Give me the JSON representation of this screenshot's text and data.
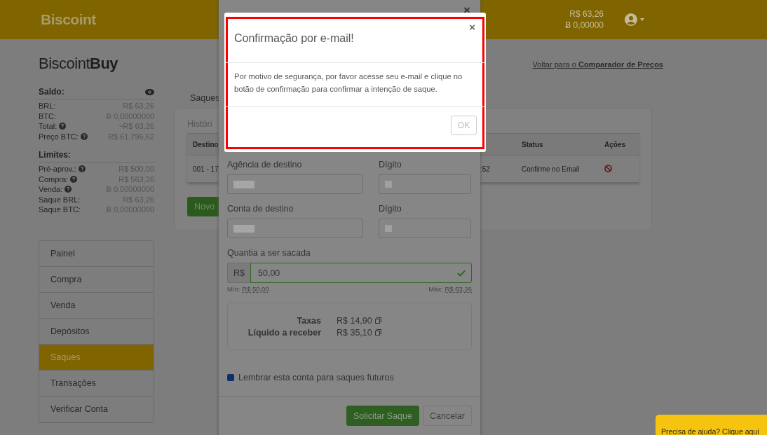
{
  "header": {
    "logo": "Biscoint",
    "balance_brl": "R$ 63,26",
    "balance_btc": "Ƀ 0,00000"
  },
  "sidebar": {
    "brand": "Biscoint**Buy**",
    "sections": [
      {
        "title": "Saldo:",
        "eye": true,
        "rows": [
          {
            "label": "BRL:",
            "help": false,
            "value": "R$ 63,26"
          },
          {
            "label": "BTC:",
            "help": false,
            "value": "Ƀ 0,00000000"
          },
          {
            "label": "Total:",
            "help": true,
            "value": "~R$ 63,26"
          },
          {
            "label": "Preço BTC:",
            "help": true,
            "value": "R$ 61.796,62"
          }
        ]
      },
      {
        "title": "Limites:",
        "eye": false,
        "rows": [
          {
            "label": "Pré-aprov.:",
            "help": true,
            "value": "R$ 500,00"
          },
          {
            "label": "Compra:",
            "help": true,
            "value": "R$ 563,26"
          },
          {
            "label": "Venda:",
            "help": true,
            "value": "Ƀ 0,00000000"
          },
          {
            "label": "Saque BRL:",
            "help": false,
            "value": "R$ 63,26"
          },
          {
            "label": "Saque BTC:",
            "help": false,
            "value": "Ƀ 0,00000000"
          }
        ]
      }
    ],
    "nav": [
      {
        "label": "Painel",
        "selected": false
      },
      {
        "label": "Compra",
        "selected": false
      },
      {
        "label": "Venda",
        "selected": false
      },
      {
        "label": "Depósitos",
        "selected": false
      },
      {
        "label": "Saques",
        "selected": true
      },
      {
        "label": "Transações",
        "selected": false
      },
      {
        "label": "Verificar Conta",
        "selected": false
      }
    ]
  },
  "back_link": "Voltar para o **Comparador de Preços**",
  "content": {
    "tab": "Saques",
    "panel_title": "Históri",
    "table": {
      "columns": [
        {
          "label": "Destino"
        },
        {
          "label": "Status"
        },
        {
          "label": "Ações"
        }
      ],
      "rows": [
        {
          "destino": "001 - 17",
          "column_2": ":52",
          "status": "Confirme no Email"
        }
      ]
    },
    "new_button": "Novo"
  },
  "withdraw_form": {
    "field_rows": [
      [
        {
          "label": "Agência de destino"
        },
        {
          "label": "Dígito"
        }
      ],
      [
        {
          "label": "Conta de destino"
        },
        {
          "label": "Dígito"
        }
      ]
    ],
    "amount": {
      "label": "Quantia a ser sacada",
      "prefix": "R$",
      "value": "50,00",
      "valid": true,
      "min_label": "Mín:",
      "min": "R$ 50,00",
      "max_label": "Máx:",
      "max": "R$ 63,26"
    },
    "summary": [
      {
        "label": "Taxas",
        "value": "R$ 14,90"
      },
      {
        "label": "Líquido a receber",
        "value": "R$ 35,10"
      }
    ],
    "remember": {
      "label": "Lembrar esta conta para saques futuros",
      "checked": true
    },
    "submit": "Solicitar Saque",
    "cancel": "Cancelar"
  },
  "confirm_dialog": {
    "close": "×",
    "title": "Confirmação por e-mail!",
    "message": "Por motivo de segurança, por favor acesse seu e-mail e clique no botão de confirmação para confirmar a intenção de saque.",
    "ok": {
      "label": "OK",
      "disabled": true
    }
  },
  "form_close": "×",
  "help_tab": "Precisa de ajuda? Clique aqui"
}
